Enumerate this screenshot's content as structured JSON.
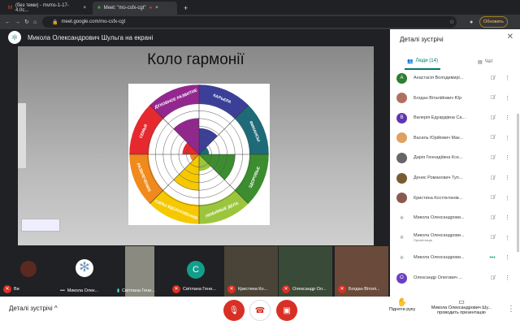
{
  "browser": {
    "tabs": [
      {
        "title": "(без теми) - mvms-1-17-4.0c...",
        "icon": "gmail-icon"
      },
      {
        "title": "Meet: \"mo-csfx-cgt\"",
        "icon": "meet-icon"
      }
    ],
    "url": "meet.google.com/mo-csfx-cgt",
    "update_label": "Обновить"
  },
  "presenter_banner": "Микола Олександрович Шульга на екрані",
  "slide": {
    "title": "Коло гармонії",
    "segments": [
      {
        "label": "КАРЬЕРА",
        "color": "#3b3f98",
        "level": 0.52
      },
      {
        "label": "ФИНАНСЫ",
        "color": "#1e6a78",
        "level": 0.2
      },
      {
        "label": "ЗДОРОВЬЕ",
        "color": "#3c8d2f",
        "level": 0.72
      },
      {
        "label": "ЛЮБИМЫЕ ДЕЛА",
        "color": "#9bc53d",
        "level": 0.33
      },
      {
        "label": "СИЛЫ ВДОХНОВЕНИЯ",
        "color": "#f5c800",
        "level": 0.72
      },
      {
        "label": "РАЗВЛЕЧЕНИЯ",
        "color": "#f08a1c",
        "level": 0.18
      },
      {
        "label": "СЕМЬЯ",
        "color": "#e5292f",
        "level": 0.33
      },
      {
        "label": "ДУХОВНОЕ РАЗВИТИЕ",
        "color": "#93278f",
        "level": 0.72
      }
    ]
  },
  "strip": [
    {
      "name": "Ви"
    },
    {
      "name": "Микола Олек..."
    },
    {
      "name": "Світлана Гени..."
    },
    {
      "name": "Світлана Гени...",
      "initial": "С"
    },
    {
      "name": "Кристина Ко..."
    },
    {
      "name": "Олександр Ол..."
    },
    {
      "name": "Богдан Вітолі..."
    }
  ],
  "bottom": {
    "details_label": "Деталі зустрічі",
    "raise_hand": "Підняти руку",
    "presenting": "Микола Олександрович Шу... проводить презентацію"
  },
  "panel": {
    "title": "Деталі зустрічі",
    "tab_people": "Люди (14)",
    "tab_chat": "Чат",
    "people": [
      {
        "name": "Анастасія Володимирі...",
        "initial": "А",
        "color": "#2e7d32"
      },
      {
        "name": "Богдан Віталійович Юр",
        "color": "#b07060"
      },
      {
        "name": "Валерія Едуардівна Са...",
        "initial": "В",
        "color": "#5e35b1"
      },
      {
        "name": "Василь Юрійович Мак...",
        "color": "#e0a060"
      },
      {
        "name": "Дарія Геннадіївна Ксе...",
        "color": "#666"
      },
      {
        "name": "Денис Романович Туп...",
        "color": "#7a5a30"
      },
      {
        "name": "Кристина Костянтинів...",
        "color": "#8a5a50"
      },
      {
        "name": "Микола Олександрови...",
        "color": "#fff"
      },
      {
        "name": "Микола Олександрови...",
        "sub": "Презентація",
        "color": "#fff"
      },
      {
        "name": "Микола Олександрови...",
        "color": "#fff",
        "speaking": true
      },
      {
        "name": "Олександр Олегович ...",
        "initial": "О",
        "color": "#6a3fc1"
      }
    ]
  }
}
